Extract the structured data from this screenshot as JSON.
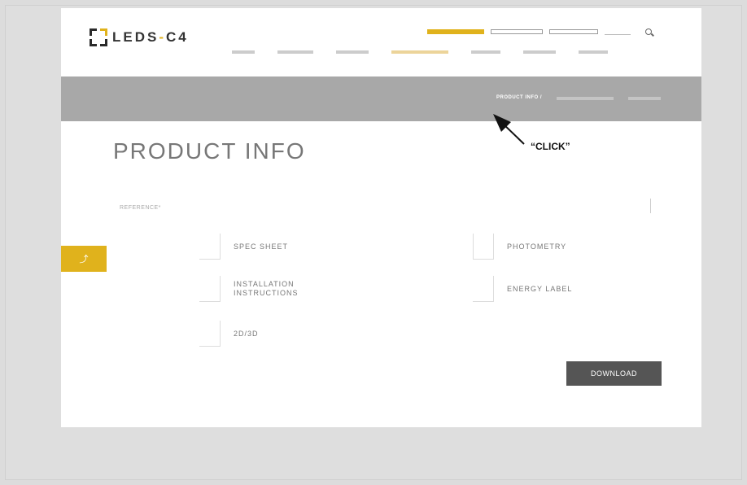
{
  "logo": {
    "text_main": "LEDS",
    "text_sep": "-",
    "text_tail": "C4"
  },
  "top_links": {
    "yellow_button": "",
    "btn1": "",
    "btn2": "",
    "lang": ""
  },
  "nav": [],
  "breadcrumbs": {
    "current": "PRODUCT INFO",
    "separator": "/"
  },
  "page_title": "PRODUCT INFO",
  "reference": {
    "label": "REFERENCE*"
  },
  "options": {
    "spec_sheet": "SPEC SHEET",
    "photometry": "PHOTOMETRY",
    "installation_line1": "INSTALLATION",
    "installation_line2": "INSTRUCTIONS",
    "energy_label": "ENERGY LABEL",
    "two_d_three_d": "2D/3D"
  },
  "download_label": "DOWNLOAD",
  "annotation": {
    "text": "“CLICK”"
  },
  "colors": {
    "accent": "#e0b21c",
    "bar": "#a8a8a8",
    "button": "#555555"
  }
}
